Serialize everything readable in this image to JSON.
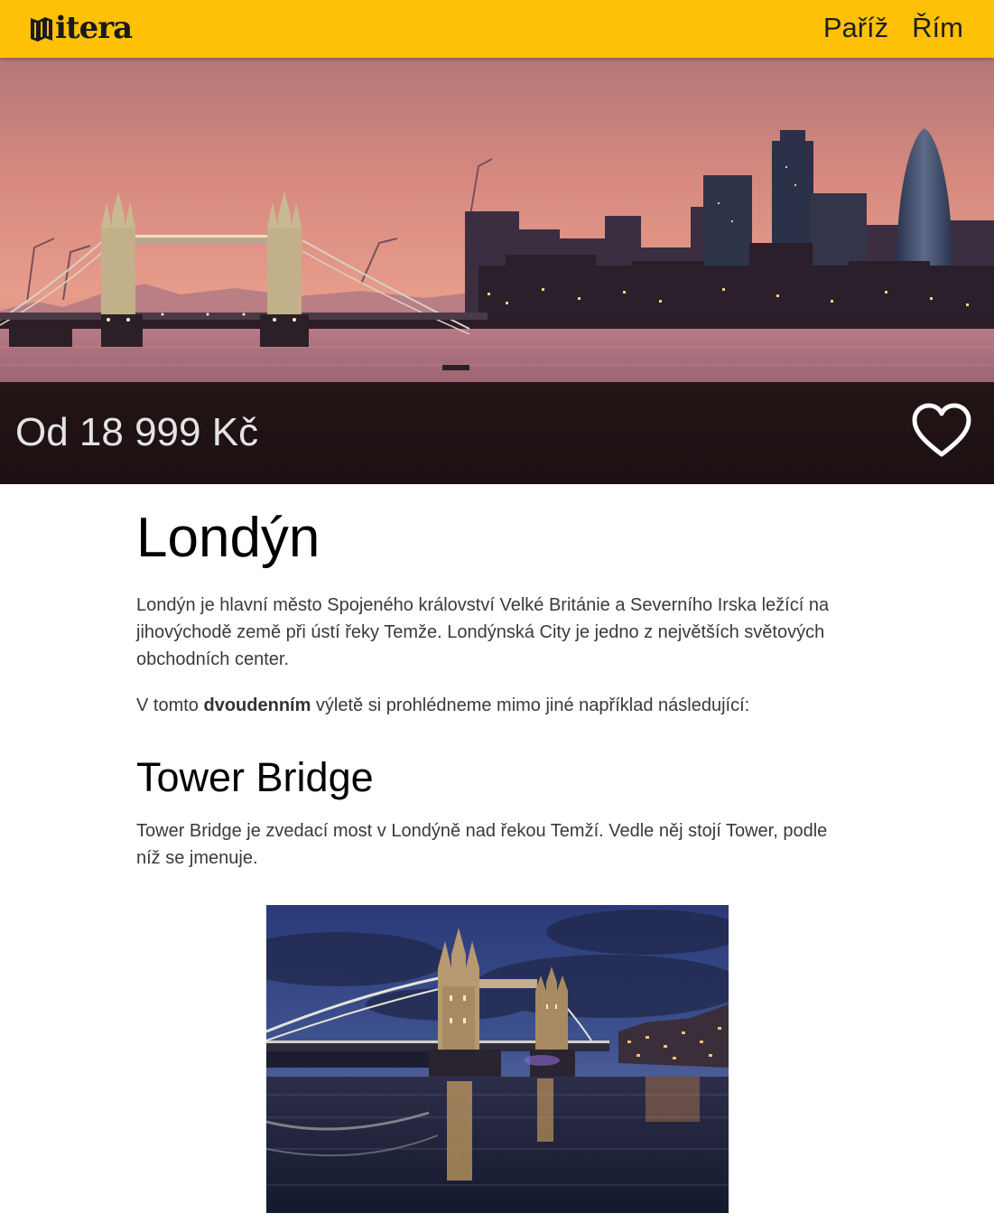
{
  "header": {
    "logo_text": "itera",
    "nav": [
      {
        "label": "Paříž"
      },
      {
        "label": "Řím"
      }
    ]
  },
  "hero": {
    "price": "Od 18 999 Kč",
    "favorite_icon": "heart-outline-icon"
  },
  "article": {
    "title": "Londýn",
    "intro": "Londýn je hlavní město Spojeného království Velké Británie a Severního Irska ležící na jihovýchodě země při ústí řeky Temže. Londýnská City je jedno z největších světových obchodních center.",
    "trip_prefix": "V tomto ",
    "trip_bold": "dvoudenním",
    "trip_suffix": " výletě si prohlédneme mimo jiné například následující:",
    "section_title": "Tower Bridge",
    "section_text": "Tower Bridge je zvedací most v Londýně nad řekou Temží. Vedle něj stojí Tower, podle níž se jmenuje."
  },
  "colors": {
    "header_bg": "#ffc107",
    "price_bar_bg": "#140c0c",
    "price_text": "#e4e4e4"
  }
}
